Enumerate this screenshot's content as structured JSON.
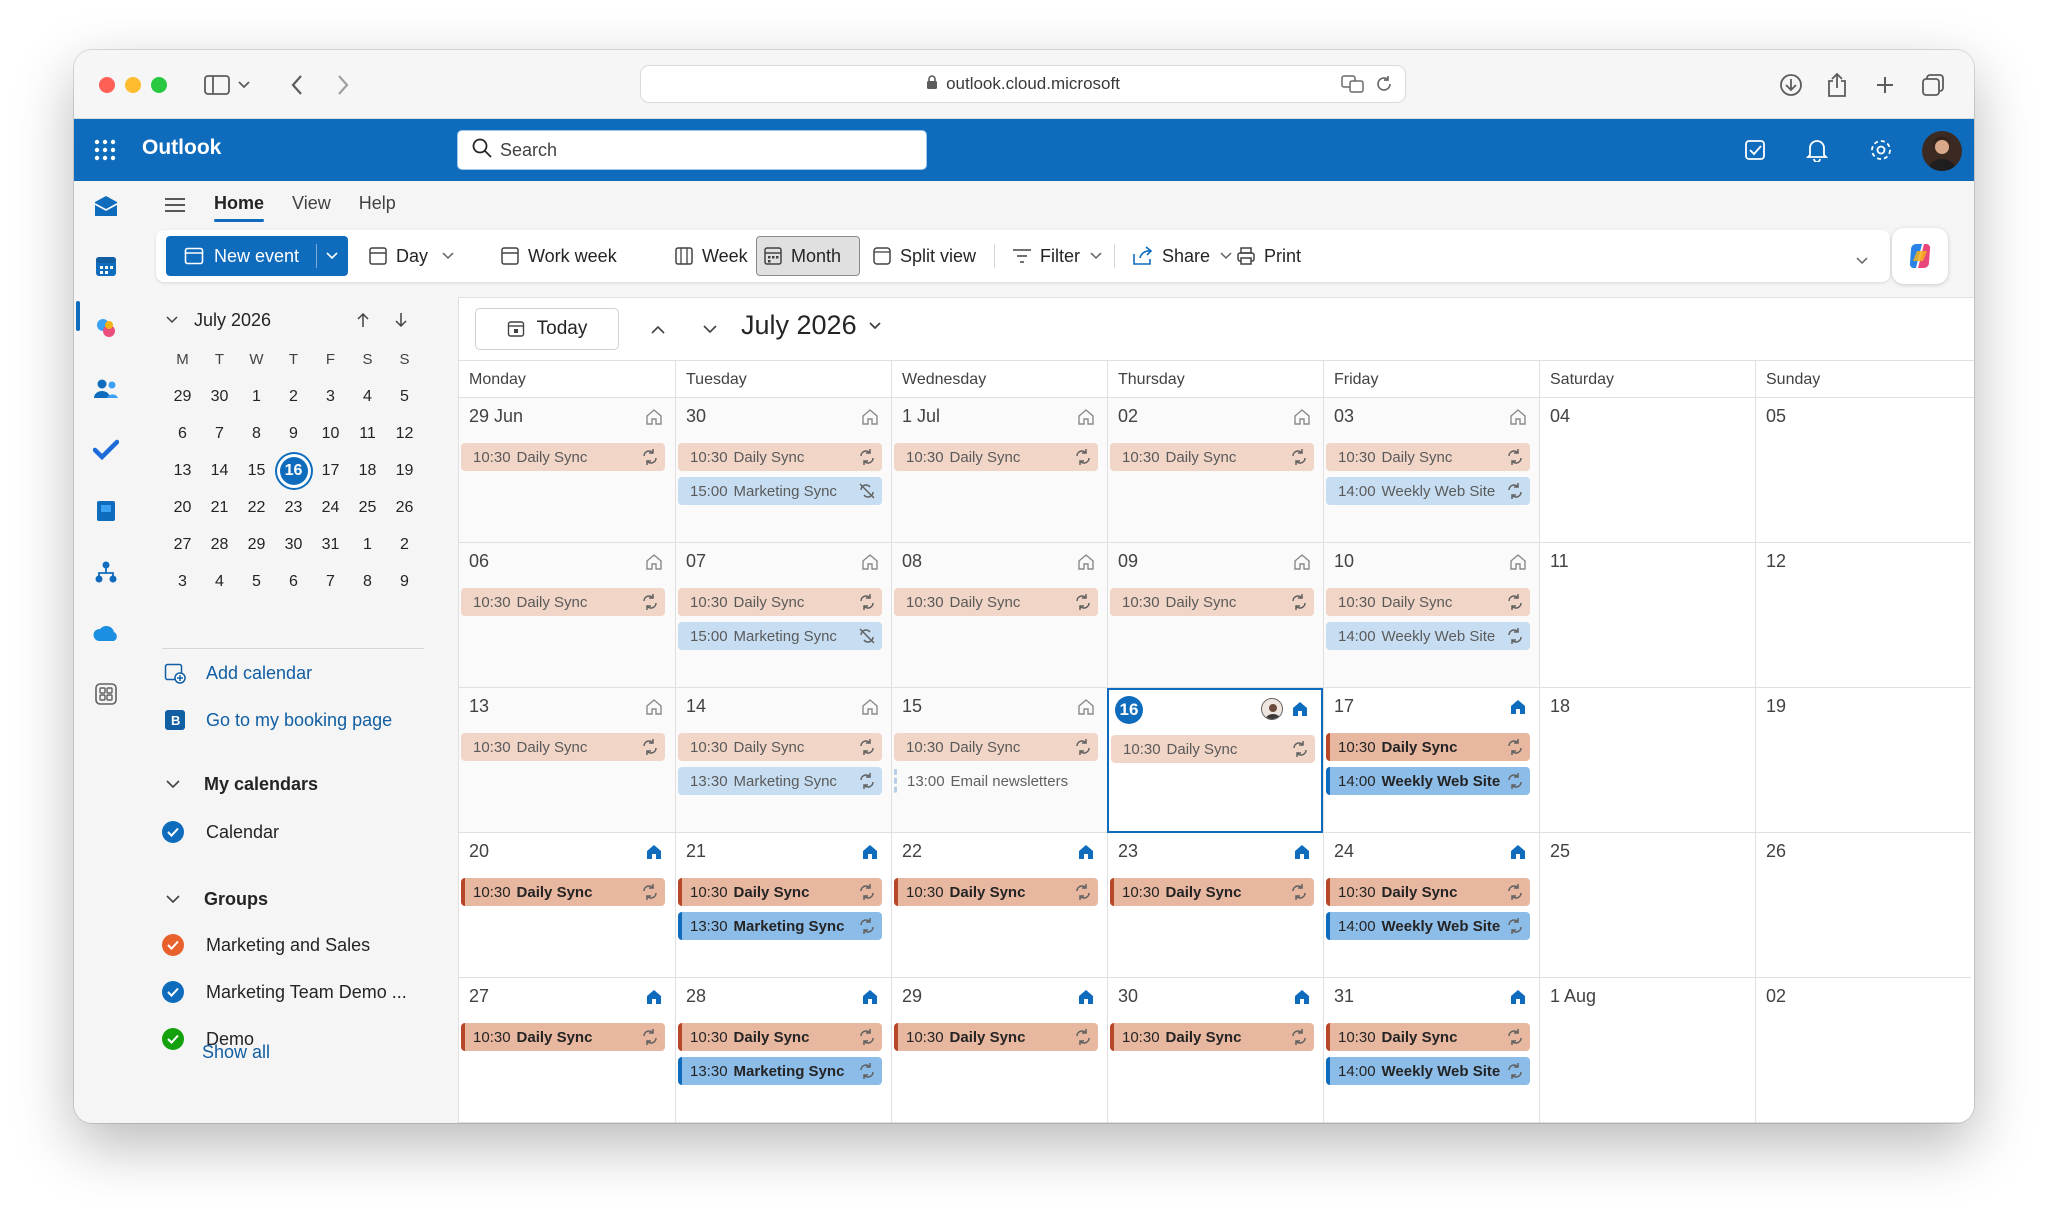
{
  "browser": {
    "url": "outlook.cloud.microsoft"
  },
  "header": {
    "app_name": "Outlook",
    "search_placeholder": "Search"
  },
  "menu": {
    "tabs": [
      "Home",
      "View",
      "Help"
    ],
    "active": "Home"
  },
  "ribbon": {
    "new_event": "New event",
    "day": "Day",
    "work_week": "Work week",
    "week": "Week",
    "month": "Month",
    "split_view": "Split view",
    "filter": "Filter",
    "share": "Share",
    "print": "Print"
  },
  "mini_calendar": {
    "title": "July 2026",
    "dow": [
      "M",
      "T",
      "W",
      "T",
      "F",
      "S",
      "S"
    ],
    "weeks": [
      [
        "29",
        "30",
        "1",
        "2",
        "3",
        "4",
        "5"
      ],
      [
        "6",
        "7",
        "8",
        "9",
        "10",
        "11",
        "12"
      ],
      [
        "13",
        "14",
        "15",
        "16",
        "17",
        "18",
        "19"
      ],
      [
        "20",
        "21",
        "22",
        "23",
        "24",
        "25",
        "26"
      ],
      [
        "27",
        "28",
        "29",
        "30",
        "31",
        "1",
        "2"
      ],
      [
        "3",
        "4",
        "5",
        "6",
        "7",
        "8",
        "9"
      ]
    ],
    "today": "16"
  },
  "sidebar": {
    "add_calendar": "Add calendar",
    "booking_page": "Go to my booking page",
    "my_calendars": "My calendars",
    "calendar": "Calendar",
    "groups": "Groups",
    "group_items": [
      {
        "label": "Marketing and Sales",
        "color": "#e8612c"
      },
      {
        "label": "Marketing Team Demo ...",
        "color": "#0f6cbd"
      },
      {
        "label": "Demo",
        "color": "#13a10e"
      }
    ],
    "show_all": "Show all"
  },
  "calendar": {
    "today_button": "Today",
    "title": "July 2026",
    "weekdays": [
      "Monday",
      "Tuesday",
      "Wednesday",
      "Thursday",
      "Friday",
      "Saturday",
      "Sunday"
    ],
    "weeks": [
      {
        "days": [
          "29 Jun",
          "30",
          "1 Jul",
          "02",
          "03",
          "04",
          "05"
        ]
      },
      {
        "days": [
          "06",
          "07",
          "08",
          "09",
          "10",
          "11",
          "12"
        ]
      },
      {
        "days": [
          "13",
          "14",
          "15",
          "16",
          "17",
          "18",
          "19"
        ]
      },
      {
        "days": [
          "20",
          "21",
          "22",
          "23",
          "24",
          "25",
          "26"
        ]
      },
      {
        "days": [
          "27",
          "28",
          "29",
          "30",
          "31",
          "1 Aug",
          "02"
        ]
      }
    ],
    "today": "16",
    "events": {
      "daily_sync": {
        "time": "10:30",
        "name": "Daily Sync"
      },
      "marketing_sync_1500": {
        "time": "15:00",
        "name": "Marketing Sync"
      },
      "marketing_sync_1330": {
        "time": "13:30",
        "name": "Marketing Sync"
      },
      "weekly_web_site": {
        "time": "14:00",
        "name": "Weekly Web Site"
      },
      "email_newsletters": {
        "time": "13:00",
        "name": "Email newsletters"
      }
    }
  },
  "colors": {
    "brand": "#0f6cbd",
    "daily_sync": "#e8b7a0",
    "marketing": "#8cbce8"
  }
}
